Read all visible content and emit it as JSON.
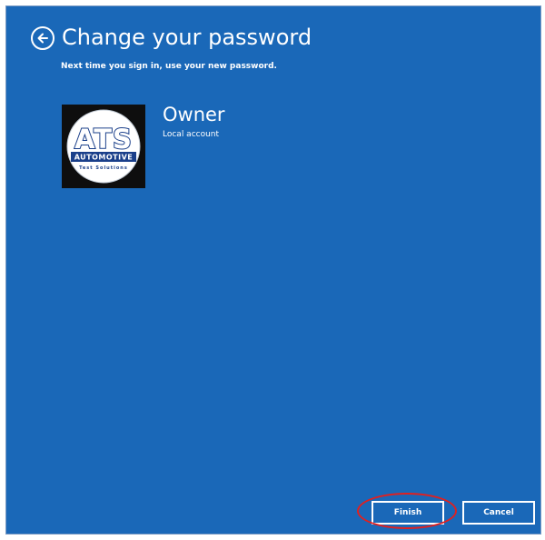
{
  "header": {
    "title": "Change your password",
    "back_icon": "back-arrow-circle-icon",
    "subtitle": "Next time you sign in, use your new password."
  },
  "account": {
    "name": "Owner",
    "type": "Local account",
    "avatar": {
      "logo_text": "ATS",
      "logo_subtext": "AUTOMOTIVE",
      "logo_tagline": "Test Solutions"
    }
  },
  "buttons": {
    "finish": "Finish",
    "cancel": "Cancel"
  },
  "colors": {
    "background": "#1a68b8",
    "text": "#ffffff",
    "highlight": "#e02020"
  }
}
